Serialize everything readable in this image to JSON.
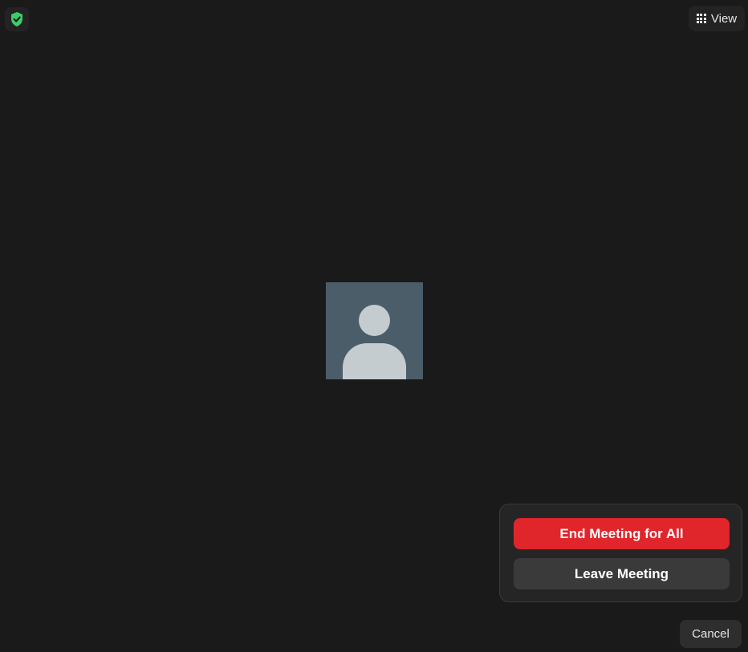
{
  "top_bar": {
    "security_icon": "shield-check-icon",
    "security_color": "#3ccf68",
    "view_label": "View",
    "view_icon": "grid-icon"
  },
  "video": {
    "participant_avatar": "person-placeholder-icon"
  },
  "leave_dialog": {
    "end_all_label": "End Meeting for All",
    "end_all_color": "#e0252b",
    "leave_label": "Leave Meeting",
    "cancel_label": "Cancel"
  }
}
